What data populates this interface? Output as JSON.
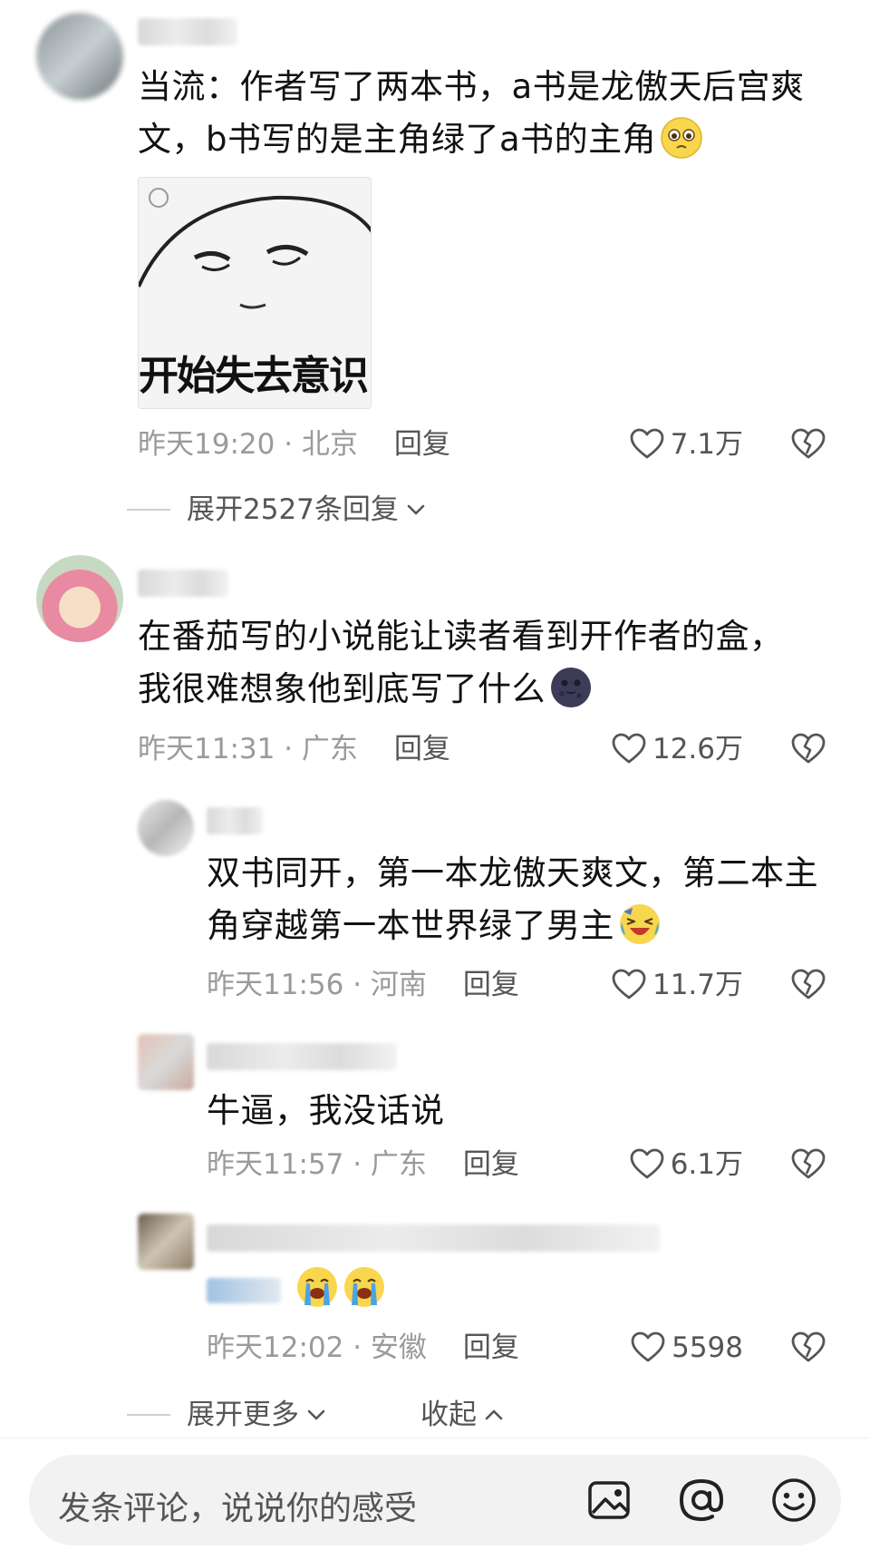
{
  "comments": [
    {
      "text_line1": "当流：作者写了两本书，a书是龙傲天后宫爽",
      "text_line2": "文，b书写的是主角绿了a书的主角",
      "emoji": "pleading-face",
      "meme_caption": "开始失去意识",
      "time": "昨天19:20",
      "location": "北京",
      "reply_label": "回复",
      "likes": "7.1万",
      "expand_label": "展开2527条回复"
    },
    {
      "text_line1": "在番茄写的小说能让读者看到开作者的盒，",
      "text_line2": "我很难想象他到底写了什么",
      "emoji": "dark-moon-face",
      "time": "昨天11:31",
      "location": "广东",
      "reply_label": "回复",
      "likes": "12.6万"
    }
  ],
  "replies": [
    {
      "text_line1": "双书同开，第一本龙傲天爽文，第二本主",
      "text_line2": "角穿越第一本世界绿了男主",
      "emoji": "laughing-crying-face",
      "time": "昨天11:56",
      "location": "河南",
      "reply_label": "回复",
      "likes": "11.7万"
    },
    {
      "text_line1": "牛逼，我没话说",
      "time": "昨天11:57",
      "location": "广东",
      "reply_label": "回复",
      "likes": "6.1万"
    },
    {
      "emoji": "loudly-crying-face",
      "time": "昨天12:02",
      "location": "安徽",
      "reply_label": "回复",
      "likes": "5598"
    }
  ],
  "footer": {
    "expand_more": "展开更多",
    "collapse": "收起"
  },
  "comment_bar": {
    "placeholder": "发条评论，说说你的感受"
  },
  "colors": {
    "text": "#111111",
    "meta": "#9a9a9a",
    "secondary": "#555555",
    "input_bg": "#f2f2f2"
  }
}
